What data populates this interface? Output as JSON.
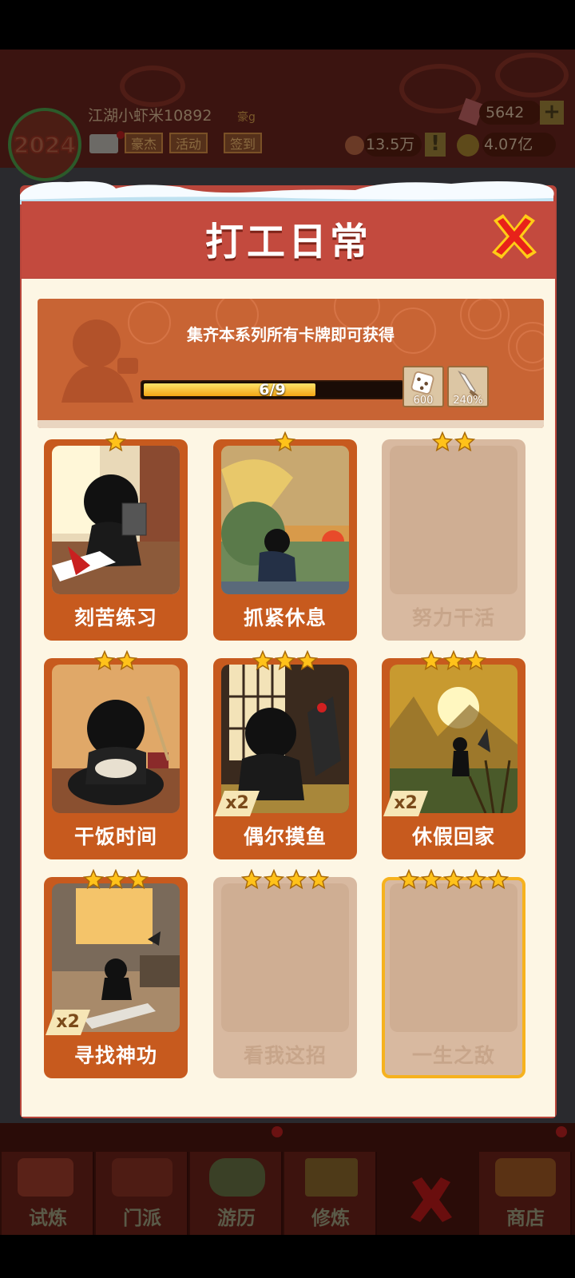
{
  "header": {
    "player_name": "江湖小虾米10892",
    "player_rank": "豪g",
    "year_badge": "2024",
    "buttons": [
      "豪杰",
      "活动",
      "签到"
    ],
    "gems": "5642",
    "power": "13.5万",
    "coins": "4.07亿"
  },
  "modal": {
    "title": "打工日常",
    "banner_text": "集齐本系列所有卡牌即可获得",
    "progress": {
      "current": 6,
      "total": 9,
      "label": "6/9"
    },
    "rewards": [
      {
        "icon": "dice-icon",
        "label": "600"
      },
      {
        "icon": "sword-icon",
        "label": "240%"
      }
    ],
    "cards": [
      {
        "name": "刻苦练习",
        "stars": 1,
        "locked": false,
        "badge": ""
      },
      {
        "name": "抓紧休息",
        "stars": 1,
        "locked": false,
        "badge": ""
      },
      {
        "name": "努力干活",
        "stars": 2,
        "locked": true,
        "badge": ""
      },
      {
        "name": "干饭时间",
        "stars": 2,
        "locked": false,
        "badge": ""
      },
      {
        "name": "偶尔摸鱼",
        "stars": 3,
        "locked": false,
        "badge": "x2"
      },
      {
        "name": "休假回家",
        "stars": 3,
        "locked": false,
        "badge": "x2"
      },
      {
        "name": "寻找神功",
        "stars": 3,
        "locked": false,
        "badge": "x2"
      },
      {
        "name": "看我这招",
        "stars": 4,
        "locked": true,
        "badge": ""
      },
      {
        "name": "一生之敌",
        "stars": 5,
        "locked": true,
        "badge": ""
      }
    ]
  },
  "bottom_nav": {
    "tabs": [
      "试炼",
      "门派",
      "游历",
      "修炼",
      "",
      "商店"
    ]
  },
  "colors": {
    "accent_red": "#c34a3e",
    "card_orange": "#c75a1e",
    "star_gold": "#ffc21a"
  }
}
